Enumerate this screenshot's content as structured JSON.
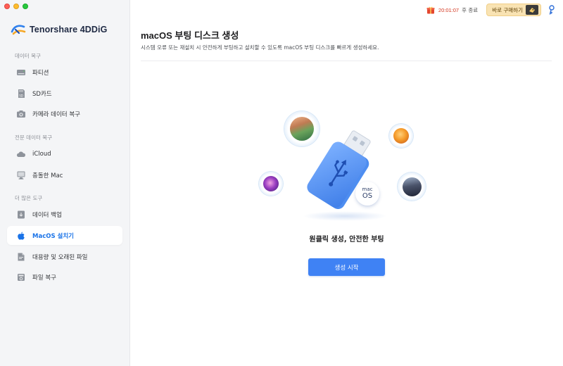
{
  "brand": {
    "name": "Tenorshare 4DDiG"
  },
  "sidebar": {
    "sections": [
      {
        "label": "데이터 복구"
      },
      {
        "label": "전문 데이터 복구"
      },
      {
        "label": "더 많은 도구"
      }
    ],
    "items": [
      {
        "label": "파티션",
        "icon": "partition-icon"
      },
      {
        "label": "SD카드",
        "icon": "sd-card-icon"
      },
      {
        "label": "카메라 데이터 복구",
        "icon": "camera-icon"
      },
      {
        "label": "iCloud",
        "icon": "icloud-icon"
      },
      {
        "label": "충돌한 Mac",
        "icon": "crashed-mac-icon"
      },
      {
        "label": "데이터 백업",
        "icon": "data-backup-icon"
      },
      {
        "label": "MacOS 설치기",
        "icon": "apple-icon",
        "active": true
      },
      {
        "label": "대용량 및 오래된 파일",
        "icon": "large-file-icon"
      },
      {
        "label": "파일 복구",
        "icon": "file-repair-icon"
      }
    ]
  },
  "topbar": {
    "timer": "20:01:07",
    "timer_suffix": "후 종료",
    "buy_label": "바로 구매하기"
  },
  "main": {
    "title": "macOS 부팅 디스크 생성",
    "description": "시스템 오류 또는 재설치 시 안전하게 부팅하고 설치할 수 있도록 macOS 부팅 디스크를 빠르게 생성하세요.",
    "usb_label_top": "mac",
    "usb_label_bottom": "OS",
    "headline": "원클릭 생성, 안전한 부팅",
    "start_button": "생성 시작"
  },
  "colors": {
    "accent": "#3f82f4",
    "active_text": "#1a73e8",
    "timer": "#d4361f"
  }
}
